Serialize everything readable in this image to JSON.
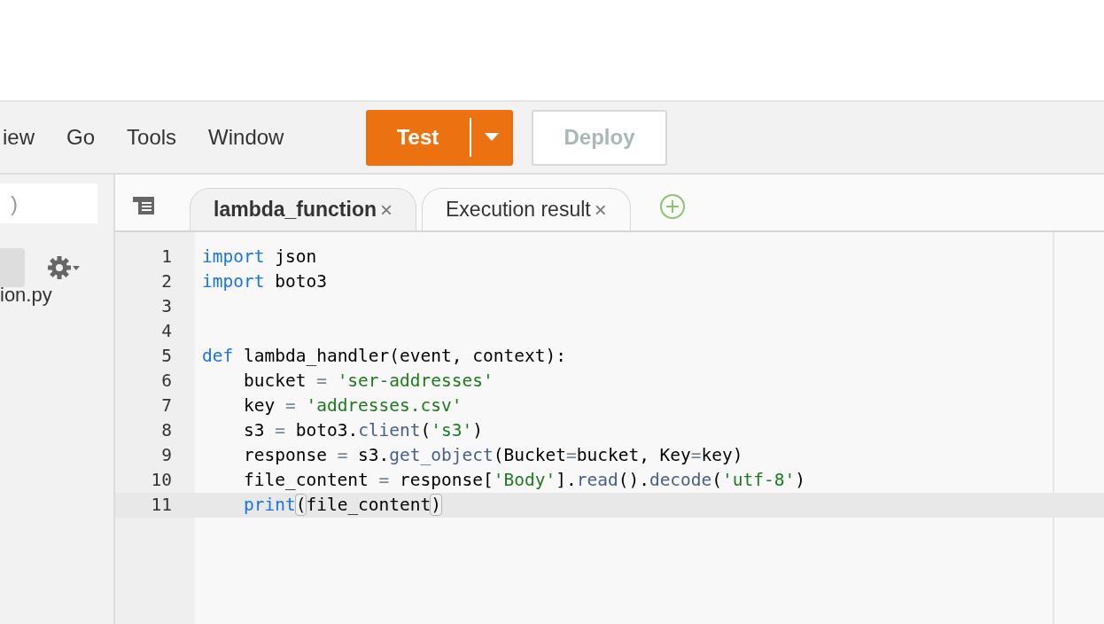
{
  "menu": [
    "iew",
    "Go",
    "Tools",
    "Window"
  ],
  "toolbar": {
    "test_button": "Test",
    "deploy_button": {
      "label": "Deploy",
      "disabled": true
    }
  },
  "sidebar": {
    "search": {
      "placeholder": ")"
    },
    "files": [
      {
        "name": "ion.py"
      }
    ]
  },
  "tabs": [
    {
      "label": "lambda_function",
      "selected": true,
      "close": "×"
    },
    {
      "label": "Execution result",
      "selected": false,
      "close": "×"
    }
  ],
  "editor": {
    "lines": [
      {
        "number": "1",
        "active": false,
        "tokens": [
          {
            "kind": "keyword",
            "text": "import"
          },
          {
            "kind": "plain",
            "text": " json"
          }
        ]
      },
      {
        "number": "2",
        "active": false,
        "tokens": [
          {
            "kind": "keyword",
            "text": "import"
          },
          {
            "kind": "plain",
            "text": " boto3"
          }
        ]
      },
      {
        "number": "3",
        "active": false
      },
      {
        "number": "4",
        "active": false
      },
      {
        "number": "5",
        "active": false,
        "tokens": [
          {
            "kind": "keyword",
            "text": "def"
          },
          {
            "kind": "plain",
            "text": " lambda_handler(event, context):"
          }
        ]
      },
      {
        "number": "6",
        "active": false,
        "tokens": [
          {
            "kind": "plain",
            "text": "    bucket "
          },
          {
            "kind": "operator",
            "text": "="
          },
          {
            "kind": "string",
            "text": " 'ser-addresses'"
          }
        ]
      },
      {
        "number": "7",
        "active": false,
        "tokens": [
          {
            "kind": "plain",
            "text": "    key "
          },
          {
            "kind": "operator",
            "text": "="
          },
          {
            "kind": "string",
            "text": " 'addresses.csv'"
          }
        ]
      },
      {
        "number": "8",
        "active": false,
        "tokens": [
          {
            "kind": "plain",
            "text": "    s3 "
          },
          {
            "kind": "operator",
            "text": "="
          },
          {
            "kind": "plain",
            "text": " boto3."
          },
          {
            "kind": "function",
            "text": "client"
          },
          {
            "kind": "plain",
            "text": "("
          },
          {
            "kind": "string",
            "text": "'s3'"
          },
          {
            "kind": "plain",
            "text": ")"
          }
        ]
      },
      {
        "number": "9",
        "active": false,
        "tokens": [
          {
            "kind": "plain",
            "text": "    response "
          },
          {
            "kind": "operator",
            "text": "="
          },
          {
            "kind": "plain",
            "text": " s3."
          },
          {
            "kind": "function",
            "text": "get_object"
          },
          {
            "kind": "plain",
            "text": "(Bucket"
          },
          {
            "kind": "operator",
            "text": "="
          },
          {
            "kind": "plain",
            "text": "bucket, Key"
          },
          {
            "kind": "operator",
            "text": "="
          },
          {
            "kind": "plain",
            "text": "key)"
          }
        ]
      },
      {
        "number": "10",
        "active": false,
        "tokens": [
          {
            "kind": "plain",
            "text": "    file_content "
          },
          {
            "kind": "operator",
            "text": "="
          },
          {
            "kind": "plain",
            "text": " response["
          },
          {
            "kind": "string",
            "text": "'Body'"
          },
          {
            "kind": "plain",
            "text": "]."
          },
          {
            "kind": "function",
            "text": "read"
          },
          {
            "kind": "plain",
            "text": "()."
          },
          {
            "kind": "function",
            "text": "decode"
          },
          {
            "kind": "plain",
            "text": "("
          },
          {
            "kind": "string",
            "text": "'utf-8'"
          },
          {
            "kind": "plain",
            "text": ")"
          }
        ]
      },
      {
        "number": "11",
        "active": true,
        "tokens": [
          {
            "kind": "keyword",
            "text": "    print"
          },
          {
            "kind": "bracket",
            "text": "("
          },
          {
            "kind": "plain",
            "text": "file_content"
          },
          {
            "kind": "bracket",
            "text": ")"
          }
        ]
      }
    ]
  }
}
